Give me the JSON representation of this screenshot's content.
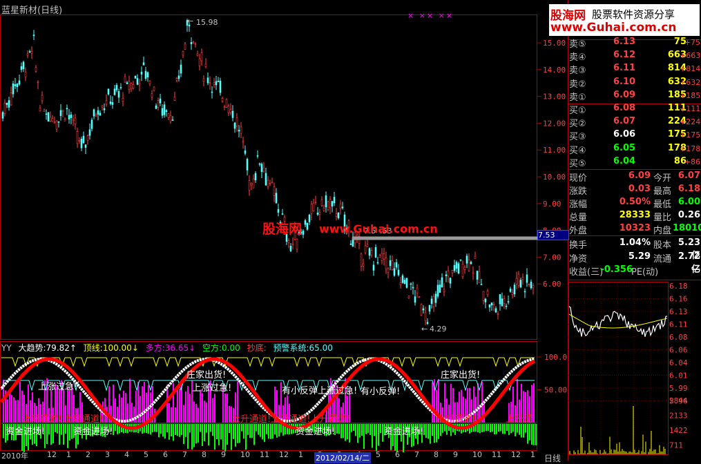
{
  "window": {
    "title": "蓝星新材(日线)",
    "top_marks": "×     ××  ××"
  },
  "main_chart": {
    "y_labels": [
      "15.00",
      "14.00",
      "13.00",
      "12.00",
      "11.00",
      "10.00",
      "9.00",
      "8.00",
      "7.00",
      "6.00"
    ],
    "high_label": "15.98",
    "low_label": "4.29",
    "mid_label": "7.5 .53",
    "price_tag": "7.53",
    "watermark_cn": "股海网",
    "watermark_url": "www.Guhai.com.cn"
  },
  "indicator": {
    "header": {
      "name": "YY",
      "trend": "大趋势:79.82↑",
      "top": "顶线:100.00↓",
      "bull": "多方:36.65↓",
      "bear": "空方:0.00",
      "bottom": "抄底:",
      "warn": "预警系统:65.00"
    },
    "y_labels": [
      "100.0",
      "50.00"
    ],
    "annotations": {
      "a1": "上涨过急!",
      "a2": "庄家出货!",
      "a3": "上涨过急!",
      "a4": "有小反弹上涨过急!",
      "a5": "有小反弹!",
      "a6": "庄家出货!",
      "b1": "上升通道!",
      "b2": "上升通道!",
      "b3": "上升通道!上升通道!上升通道!",
      "b4": "上升通道!",
      "b5": "上升通",
      "c1": "资金进场!",
      "c2": "资金进场!",
      "c3": "资金进场!",
      "c4": "资金进场!"
    }
  },
  "bottom_axis": {
    "labels": [
      "2010年",
      "12",
      "1",
      "2",
      "3",
      "4",
      "5",
      "6",
      "7",
      "8",
      "9",
      "10",
      "11",
      "12",
      "1",
      "2",
      "3",
      "4",
      "5",
      "6",
      "7",
      "8",
      "9",
      "10",
      "11",
      "12",
      "1"
    ],
    "highlight": "2012/02/14/二",
    "period": "日线"
  },
  "logo": {
    "cn": "股海网",
    "slogan": "股票软件资源分享",
    "url": "www.Guhai.com.cn"
  },
  "orderbook": {
    "sells": [
      {
        "label": "卖⑤",
        "price": "6.13",
        "vol": "75",
        "chg": "+75"
      },
      {
        "label": "卖④",
        "price": "6.12",
        "vol": "663",
        "chg": "+663"
      },
      {
        "label": "卖③",
        "price": "6.11",
        "vol": "814",
        "chg": "+814"
      },
      {
        "label": "卖②",
        "price": "6.10",
        "vol": "632",
        "chg": "+632"
      },
      {
        "label": "卖①",
        "price": "6.09",
        "vol": "185",
        "chg": "+185"
      }
    ],
    "buys": [
      {
        "label": "买①",
        "price": "6.08",
        "vol": "111",
        "chg": "+111"
      },
      {
        "label": "买②",
        "price": "6.07",
        "vol": "224",
        "chg": "+224"
      },
      {
        "label": "买③",
        "price": "6.06",
        "vol": "175",
        "chg": "+175"
      },
      {
        "label": "买④",
        "price": "6.05",
        "vol": "178",
        "chg": "+178"
      },
      {
        "label": "买⑤",
        "price": "6.04",
        "vol": "86",
        "chg": "+86"
      }
    ]
  },
  "stats": [
    {
      "l1": "现价",
      "v1": "6.09",
      "l2": "今开",
      "v2": "6.07"
    },
    {
      "l1": "涨跌",
      "v1": "0.03",
      "l2": "最高",
      "v2": "6.18"
    },
    {
      "l1": "涨幅",
      "v1": "0.50%",
      "l2": "最低",
      "v2": "6.00"
    },
    {
      "l1": "总量",
      "v1": "28333",
      "l2": "量比",
      "v2": "0.26"
    },
    {
      "l1": "外盘",
      "v1": "10323",
      "l2": "内盘",
      "v2": "18010"
    },
    {
      "l1": "换手",
      "v1": "1.04%",
      "l2": "股本",
      "v2": "5.23亿"
    },
    {
      "l1": "净资",
      "v1": "5.29",
      "l2": "流通",
      "v2": "2.72亿"
    },
    {
      "l1": "收益(三)",
      "v1": "-0.356",
      "l2": "PE(动)",
      "v2": "—"
    }
  ],
  "mini_chart": {
    "price_labels": [
      "6.18",
      "6.16",
      "6.13",
      "6.11",
      "6.08",
      "6.06",
      "6.04",
      "6.01",
      "5.99",
      "5.96"
    ],
    "vol_labels": [
      "2844",
      "2133",
      "1422",
      "711"
    ]
  },
  "colors": {
    "up": "#ff4040",
    "down": "#54ffff",
    "frame": "#b00000",
    "bg": "#000000"
  }
}
